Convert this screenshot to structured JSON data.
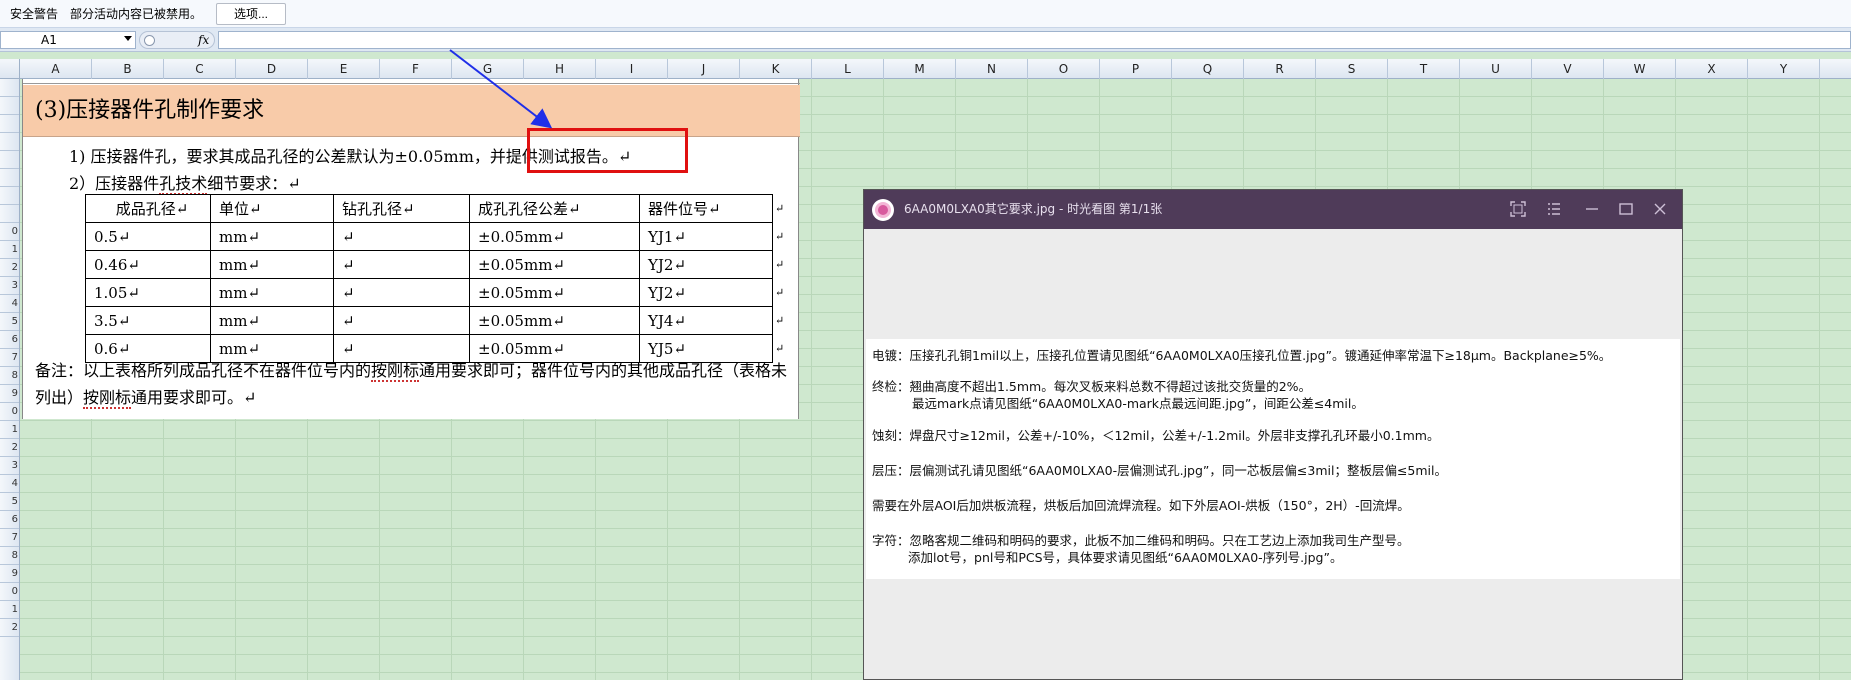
{
  "security_bar": {
    "title": "安全警告",
    "message": "部分活动内容已被禁用。",
    "options_button": "选项..."
  },
  "formula_bar": {
    "name_box": "A1",
    "fx_label": "fx",
    "formula": ""
  },
  "columns": [
    "A",
    "B",
    "C",
    "D",
    "E",
    "F",
    "G",
    "H",
    "I",
    "J",
    "K",
    "L",
    "M",
    "N",
    "O",
    "P",
    "Q",
    "R",
    "S",
    "T",
    "U",
    "V",
    "W",
    "X",
    "Y"
  ],
  "rows": [
    "",
    "",
    "",
    "",
    "",
    "",
    "",
    "",
    "0",
    "1",
    "2",
    "3",
    "4",
    "5",
    "6",
    "7",
    "8",
    "9",
    "0",
    "1",
    "2",
    "3",
    "4",
    "5",
    "6",
    "7",
    "8",
    "9",
    "0",
    "1",
    "2"
  ],
  "document": {
    "heading": "(3)压接器件孔制作要求",
    "line1_prefix": "1) 压接器件孔，要求其成品孔径的公差默认为±0.05mm，",
    "line1_highlight": "并提供测试报告。",
    "line1_mark": "↵",
    "line2_a": "2）压接器件",
    "line2_b": "孔技术",
    "line2_c": "细节要求：↵",
    "table": {
      "headers": [
        "成品孔径↵",
        "单位↵",
        "钻孔孔径↵",
        "成孔孔径公差↵",
        "器件位号↵"
      ],
      "rows": [
        [
          "0.5↵",
          "mm↵",
          "↵",
          "±0.05mm↵",
          "YJ1↵"
        ],
        [
          "0.46↵",
          "mm↵",
          "↵",
          "±0.05mm↵",
          "YJ2↵"
        ],
        [
          "1.05↵",
          "mm↵",
          "↵",
          "±0.05mm↵",
          "YJ2↵"
        ],
        [
          "3.5↵",
          "mm↵",
          "↵",
          "±0.05mm↵",
          "YJ4↵"
        ],
        [
          "0.6↵",
          "mm↵",
          "↵",
          "±0.05mm↵",
          "YJ5↵"
        ]
      ],
      "row_end_mark": "↵"
    },
    "remark_a": "备注：以上表格所列成品孔径不在器件位号内的",
    "remark_b": "按刚标",
    "remark_c": "通用要求即可；器件位号内的其他成品孔径（表格未列出）",
    "remark_d": "按刚标",
    "remark_e": "通用要求即可。↵"
  },
  "viewer": {
    "title": "6AA0M0LXA0其它要求.jpg - 时光看图 第1/1张",
    "lines": [
      "电镀：压接孔孔铜1mil以上，压接孔位置请见图纸“6AA0M0LXA0压接孔位置.jpg”。镀通延伸率常温下≥18μm。Backplane≥5%。",
      "终检：翘曲高度不超出1.5mm。每次叉板来料总数不得超过该批交货量的2%。",
      "最远mark点请见图纸“6AA0M0LXA0-mark点最远间距.jpg”，间距公差≤4mil。",
      "蚀刻：焊盘尺寸≥12mil，公差+/-10%，＜12mil，公差+/-1.2mil。外层非支撑孔孔环最小0.1mm。",
      "层压：层偏测试孔请见图纸“6AA0M0LXA0-层偏测试孔.jpg”，同一芯板层偏≤3mil；整板层偏≤5mil。",
      "需要在外层AOI后加烘板流程，烘板后加回流焊流程。如下外层AOI-烘板（150°，2H）-回流焊。",
      "字符：忽略客规二维码和明码的要求，此板不加二维码和明码。只在工艺边上添加我司生产型号。",
      "添加lot号，pnl号和PCS号，具体要求请见图纸“6AA0M0LXA0-序列号.jpg”。"
    ]
  },
  "colors": {
    "sheet_background": "#cfe8cf",
    "heading_fill": "#f8cba9",
    "annotation_box": "#e01010",
    "annotation_arrow": "#1f2fe8",
    "viewer_titlebar": "#4f3b59"
  }
}
